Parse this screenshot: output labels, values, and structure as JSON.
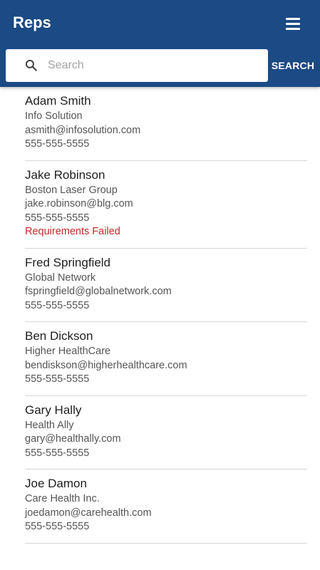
{
  "header": {
    "title": "Reps",
    "menu_icon": "hamburger-menu-icon",
    "background_color": "#1b4a84"
  },
  "search": {
    "placeholder": "Search",
    "value": "",
    "button_label": "SEARCH",
    "icon": "search-icon"
  },
  "reps": [
    {
      "name": "Adam Smith",
      "company": "Info Solution",
      "email": "asmith@infosolution.com",
      "phone": "555-555-5555",
      "status": ""
    },
    {
      "name": "Jake Robinson",
      "company": "Boston Laser Group",
      "email": "jake.robinson@blg.com",
      "phone": "555-555-5555",
      "status": "Requirements Failed"
    },
    {
      "name": "Fred Springfield",
      "company": "Global Network",
      "email": "fspringfield@globalnetwork.com",
      "phone": "555-555-5555",
      "status": ""
    },
    {
      "name": "Ben Dickson",
      "company": "Higher HealthCare",
      "email": "bendiskson@higherhealthcare.com",
      "phone": "555-555-5555",
      "status": ""
    },
    {
      "name": "Gary Hally",
      "company": "Health Ally",
      "email": "gary@healthally.com",
      "phone": "555-555-5555",
      "status": ""
    },
    {
      "name": "Joe Damon",
      "company": "Care Health Inc.",
      "email": "joedamon@carehealth.com",
      "phone": "555-555-5555",
      "status": ""
    }
  ],
  "status_color": "#c62828"
}
